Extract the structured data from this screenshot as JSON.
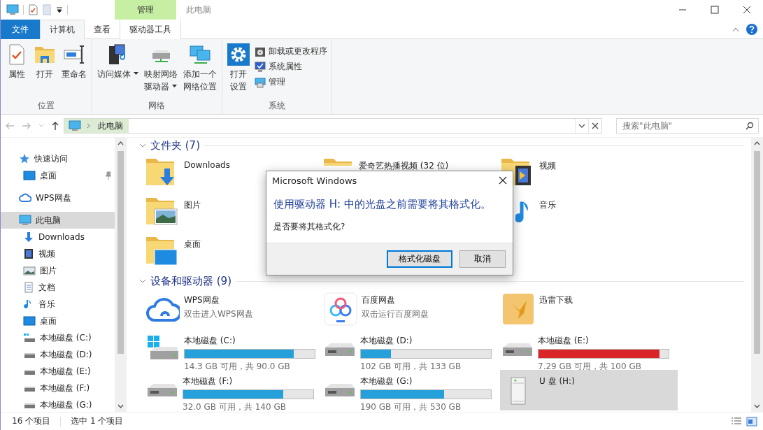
{
  "titlebar": {
    "title": "此电脑",
    "context_label": "管理"
  },
  "tabs": [
    {
      "label": "文件",
      "kind": "file",
      "selected": false
    },
    {
      "label": "计算机",
      "kind": "normal",
      "selected": true
    },
    {
      "label": "查看",
      "kind": "normal",
      "selected": false
    },
    {
      "label": "驱动器工具",
      "kind": "context",
      "selected": false
    }
  ],
  "ribbon": {
    "groups": [
      {
        "label": "位置",
        "buttons": [
          {
            "kind": "properties",
            "lines": [
              "属性"
            ],
            "dropdown": false
          },
          {
            "kind": "open",
            "lines": [
              "打开"
            ],
            "dropdown": false
          },
          {
            "kind": "rename",
            "lines": [
              "重命名"
            ],
            "dropdown": false
          }
        ]
      },
      {
        "label": "网络",
        "buttons": [
          {
            "kind": "media",
            "lines": [
              "访问媒体"
            ],
            "dropdown": true
          },
          {
            "kind": "netdrive",
            "lines": [
              "映射网络",
              "驱动器"
            ],
            "dropdown": true
          },
          {
            "kind": "netloc",
            "lines": [
              "添加一个",
              "网络位置"
            ],
            "dropdown": false
          }
        ]
      },
      {
        "label": "系统",
        "buttons": [
          {
            "kind": "settings",
            "lines": [
              "打开",
              "设置"
            ],
            "dropdown": false
          }
        ],
        "small_buttons": [
          {
            "kind": "uninstall",
            "label": "卸载或更改程序"
          },
          {
            "kind": "sysprops",
            "label": "系统属性"
          },
          {
            "kind": "manage",
            "label": "管理"
          }
        ]
      }
    ]
  },
  "address": {
    "path": "此电脑",
    "search_placeholder": "搜索\"此电脑\""
  },
  "sidebar": {
    "items": [
      {
        "kind": "quick",
        "label": "快速访问",
        "selected": false,
        "children": [
          {
            "kind": "desktop",
            "label": "桌面",
            "selected": false,
            "pinned": true
          }
        ]
      },
      {
        "kind": "cloud",
        "label": "WPS网盘",
        "selected": false
      },
      {
        "kind": "pc",
        "label": "此电脑",
        "selected": true,
        "children": [
          {
            "kind": "download",
            "label": "Downloads",
            "selected": false
          },
          {
            "kind": "video",
            "label": "视频",
            "selected": false
          },
          {
            "kind": "picture",
            "label": "图片",
            "selected": false
          },
          {
            "kind": "doc",
            "label": "文档",
            "selected": false
          },
          {
            "kind": "music",
            "label": "音乐",
            "selected": false
          },
          {
            "kind": "desktop",
            "label": "桌面",
            "selected": false
          },
          {
            "kind": "sysdrive",
            "label": "本地磁盘 (C:)",
            "selected": false
          },
          {
            "kind": "drive",
            "label": "本地磁盘 (D:)",
            "selected": false
          },
          {
            "kind": "drive",
            "label": "本地磁盘 (E:)",
            "selected": false
          },
          {
            "kind": "drive",
            "label": "本地磁盘 (F:)",
            "selected": false
          },
          {
            "kind": "drive",
            "label": "本地磁盘 (G:)",
            "selected": false
          }
        ]
      }
    ]
  },
  "folders": {
    "title": "文件夹 (7)",
    "expanded": true,
    "columns": [
      [
        {
          "kind": "download",
          "name": "Downloads"
        },
        {
          "kind": "picture",
          "name": "图片"
        },
        {
          "kind": "desktop",
          "name": "桌面"
        }
      ],
      [
        {
          "kind": "plain",
          "name": "爱奇艺热播视频 (32 位)"
        }
      ],
      [
        {
          "kind": "video",
          "name": "视频"
        },
        {
          "kind": "music",
          "name": "音乐"
        }
      ]
    ]
  },
  "devices": {
    "title": "设备和驱动器 (9)",
    "expanded": true,
    "items": [
      {
        "kind": "wps",
        "name": "WPS网盘",
        "subtitle": "双击进入WPS网盘",
        "selected": false
      },
      {
        "kind": "baidu",
        "name": "百度网盘",
        "subtitle": "双击运行百度网盘",
        "selected": false
      },
      {
        "kind": "xunlei",
        "name": "迅雷下载",
        "selected": false
      },
      {
        "kind": "sysdrive",
        "name": "本地磁盘 (C:)",
        "level": 0.84,
        "color": "#26a0da",
        "space": "14.3 GB 可用，共 90.0 GB",
        "selected": false
      },
      {
        "kind": "drive",
        "name": "本地磁盘 (D:)",
        "level": 0.23,
        "color": "#26a0da",
        "space": "102 GB 可用，共 133 GB",
        "selected": false
      },
      {
        "kind": "drive",
        "name": "本地磁盘 (E:)",
        "level": 0.93,
        "color": "#da2626",
        "space": "7.29 GB 可用，共 100 GB",
        "selected": false
      },
      {
        "kind": "drive",
        "name": "本地磁盘 (F:)",
        "level": 0.77,
        "color": "#26a0da",
        "space": "32.0 GB 可用，共 140 GB",
        "selected": false
      },
      {
        "kind": "drive",
        "name": "本地磁盘 (G:)",
        "level": 0.64,
        "color": "#26a0da",
        "space": "190 GB 可用，共 530 GB",
        "selected": false
      },
      {
        "kind": "usb",
        "name": "U 盘 (H:)",
        "selected": true
      }
    ]
  },
  "dialog": {
    "title": "Microsoft Windows",
    "heading": "使用驱动器 H: 中的光盘之前需要将其格式化。",
    "message": "是否要将其格式化?",
    "buttons": [
      {
        "label": "格式化磁盘",
        "default": true
      },
      {
        "label": "取消",
        "default": false
      }
    ]
  },
  "status_bar": {
    "items": [
      "16 个项目",
      "选中 1 个项目"
    ]
  }
}
